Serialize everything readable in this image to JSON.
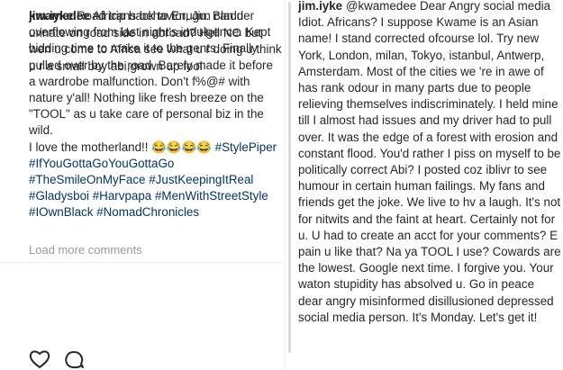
{
  "left_post": {
    "username": "jim.iyke",
    "caption_text": "Road trip back to Enugu. Bladder overflowing from last night's indulgence. Kept bidding time to make it to the gents. Finally pulled over by the road. Barely made it before a wardrobe malfunction. Don't f%@# with nature y'all! Nothing like fresh breeze on the \"TOOL\" as u take care of personal biz in the wild.",
    "caption_line2": "I love the motherland!! 😂😂😂😂 ",
    "hashtags": [
      "#StylePiper",
      "#IfYouGottaGoYouGottaGo",
      "#TheSmileOnMyFace",
      "#JustKeepingItReal",
      "#Gladysboi",
      "#Harvpapa",
      "#MenWithStreetStyle",
      "#IOwnBlack",
      "#NomadChronicles"
    ],
    "load_more_label": "Load more comments",
    "reply": {
      "username": "kwamedee",
      "text": "Africans behavior, Jim can u urinate on road side in abroad? Hell NO but wen u come to Africa see what u r doing u think u r a small boy abi,grown up fool"
    },
    "icons": [
      "heart-icon",
      "comment-icon"
    ]
  },
  "right_post": {
    "username": "jim.iyke",
    "mention": "@kwamedee",
    "text": "Dear Angry social media Idiot. Africans? I suppose Kwame is an Asian name! I stand corrected ofcourse lol. Try new York, London, milan, Tokyo, istanbul, Antwerp, Amsterdam. Most of the cities we 're in awe of has rank odour in many parts due to people relieving themselves indiscriminately. I held mine till I almost had issues and my driver had to pull over. It was the edge of a forest with erosion and constant flood. You'd rather I piss on myself to be politically correct Abi? I posted coz iblivr to see humour in certain human failings. My fans and friends get the joke. We live to hv a laugh. It's not for nitwits and the faint at heart. Certainly not for u. U had to create an acct for your comments? E pain u like that? Na ya TOOL I use? Cowards are the lowest. Google next time. I forgive you. Your waton stupidity has absolved u. Go in peace dear angry misinformed disillusioned depressed social media person. It's Monday. Let's get it!"
  }
}
